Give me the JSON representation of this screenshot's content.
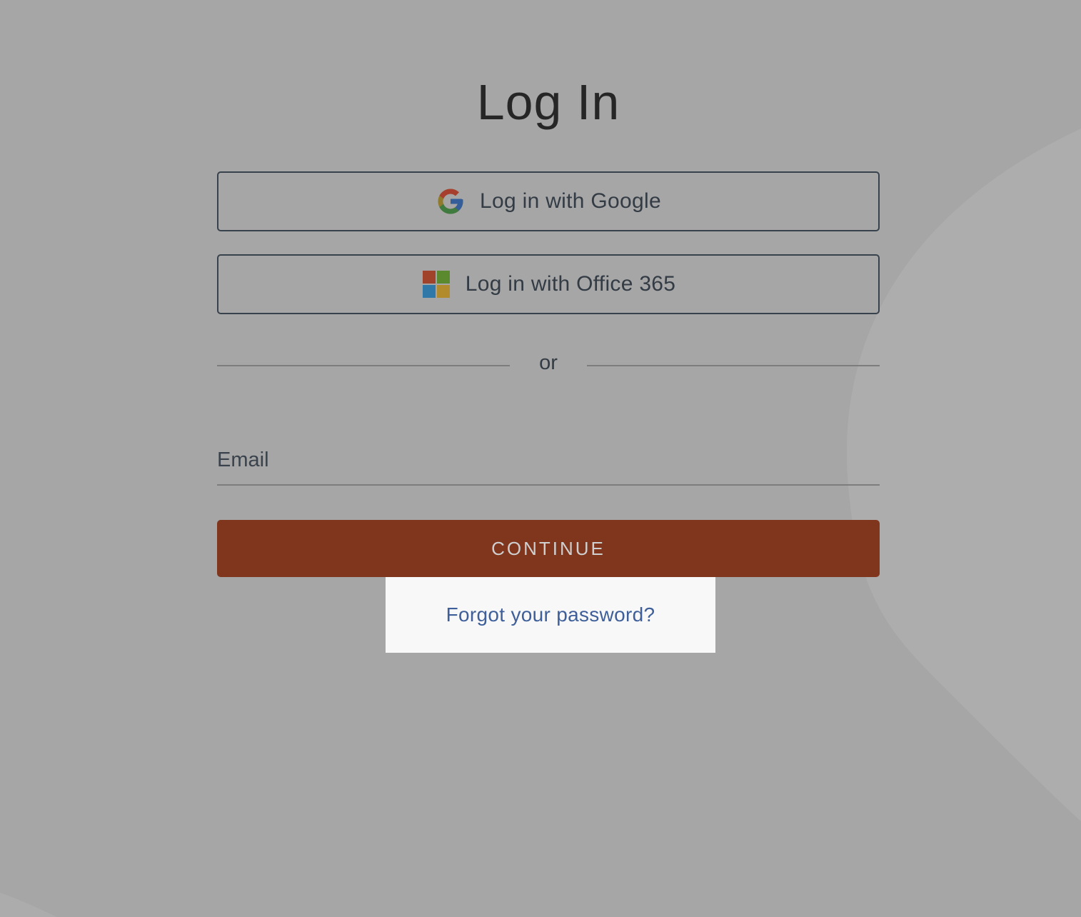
{
  "page": {
    "title": "Log In"
  },
  "sso": {
    "google": {
      "label": "Log in with Google",
      "icon": "google-g-icon"
    },
    "office": {
      "label": "Log in with Office 365",
      "icon": "microsoft-logo-icon"
    }
  },
  "divider": {
    "text": "or"
  },
  "email": {
    "placeholder": "Email",
    "value": ""
  },
  "continue": {
    "label": "CONTINUE"
  },
  "forgot": {
    "label": "Forgot your password?"
  },
  "colors": {
    "background": "#a6a6a6",
    "primary_button": "#7f361c",
    "link": "#3e5f99",
    "highlight_box": "#f8f8f8"
  }
}
